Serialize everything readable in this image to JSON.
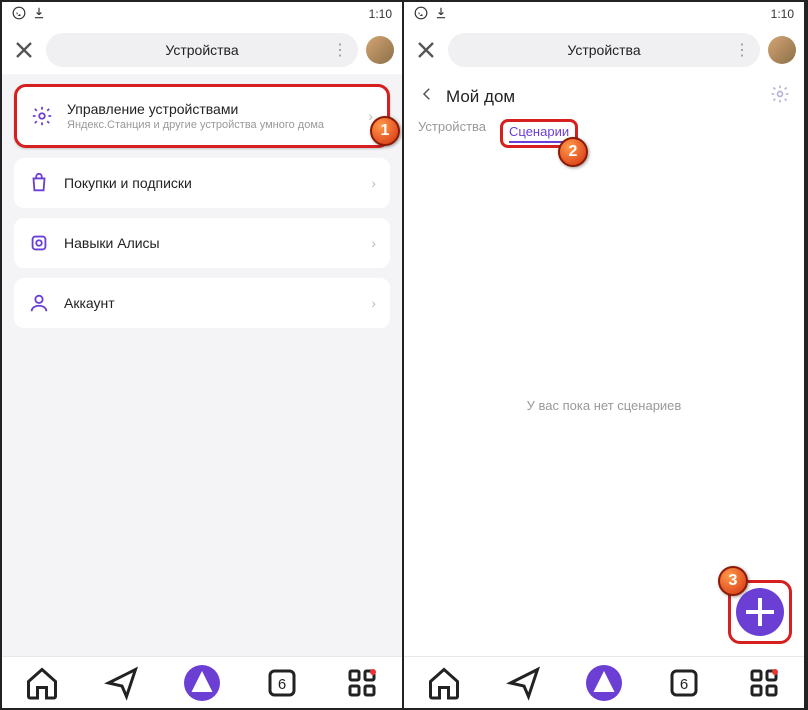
{
  "status": {
    "time": "1:10"
  },
  "left": {
    "header_title": "Устройства",
    "items": [
      {
        "title": "Управление устройствами",
        "sub": "Яндекс.Станция и другие устройства умного дома"
      },
      {
        "title": "Покупки и подписки"
      },
      {
        "title": "Навыки Алисы"
      },
      {
        "title": "Аккаунт"
      }
    ]
  },
  "right": {
    "header_title": "Устройства",
    "home_title": "Мой дом",
    "tabs": [
      "Устройства",
      "Сценарии"
    ],
    "empty": "У вас пока нет сценариев"
  },
  "nav_badge": "6",
  "markers": {
    "m1": "1",
    "m2": "2",
    "m3": "3"
  }
}
